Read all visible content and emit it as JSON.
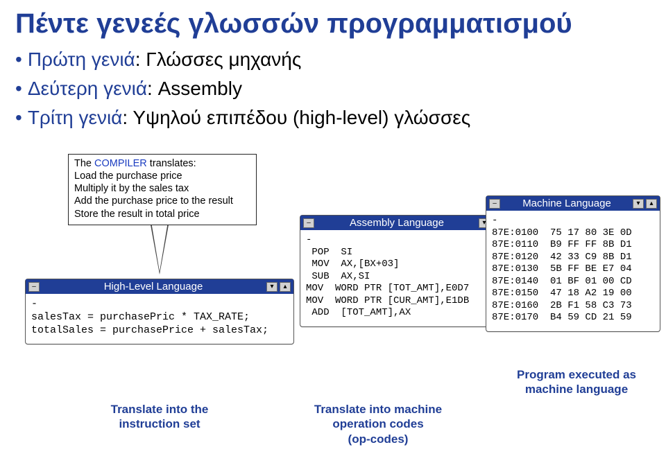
{
  "title": "Πέντε γενεές γλωσσών προγραμματισμού",
  "bullets": {
    "b1_term": "Πρώτη γενιά",
    "b1_rest": ": Γλώσσες μηχανής",
    "b2_term": "Δεύτερη γενιά",
    "b2_rest": ": Assembly",
    "b3_term": "Τρίτη γενιά",
    "b3_rest": ": Υψηλού επιπέδου (high-level) γλώσσες"
  },
  "compiler": {
    "lead_the": "The ",
    "lead_word": "COMPILER",
    "lead_rest": " translates:",
    "line1": "Load the purchase price",
    "line2": "Multiply it by the sales tax",
    "line3": "Add the purchase price to the result",
    "line4": "Store the result in total price"
  },
  "win_hll": {
    "title": "High-Level Language",
    "body": "-\nsalesTax = purchasePric * TAX_RATE;\ntotalSales = purchasePrice + salesTax;"
  },
  "win_asm": {
    "title": "Assembly Language",
    "body": "-\n POP  SI\n MOV  AX,[BX+03]\n SUB  AX,SI\nMOV  WORD PTR [TOT_AMT],E0D7\nMOV  WORD PTR [CUR_AMT],E1DB\n ADD  [TOT_AMT],AX"
  },
  "win_ml": {
    "title": "Machine Language",
    "body": "-\n87E:0100  75 17 80 3E 0D\n87E:0110  B9 FF FF 8B D1\n87E:0120  42 33 C9 8B D1\n87E:0130  5B FF BE E7 04\n87E:0140  01 BF 01 00 CD\n87E:0150  47 18 A2 19 00\n87E:0160  2B F1 58 C3 73\n87E:0170  B4 59 CD 21 59"
  },
  "captions": {
    "instr": "Translate into the\ninstruction set",
    "opcodes": "Translate into machine\noperation codes\n(op-codes)",
    "exec": "Program executed as\nmachine language"
  },
  "window_btn": {
    "minus": "–",
    "up": "▴",
    "down": "▾"
  }
}
